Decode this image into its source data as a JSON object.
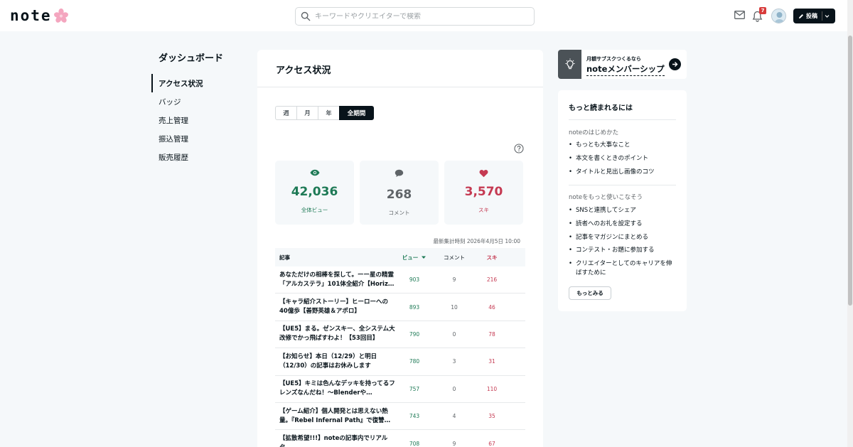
{
  "header": {
    "logo_text": "note",
    "search_placeholder": "キーワードやクリエイターで検索",
    "notification_count": "7",
    "post_label": "投稿"
  },
  "sidebar": {
    "title": "ダッシュボード",
    "items": [
      {
        "label": "アクセス状況",
        "active": true
      },
      {
        "label": "バッジ"
      },
      {
        "label": "売上管理"
      },
      {
        "label": "振込管理"
      },
      {
        "label": "販売履歴"
      }
    ]
  },
  "main": {
    "title": "アクセス状況",
    "periods": [
      "週",
      "月",
      "年",
      "全期間"
    ],
    "selected_period": "全期間",
    "stats": {
      "views": {
        "value": "42,036",
        "label": "全体ビュー"
      },
      "comments": {
        "value": "268",
        "label": "コメント"
      },
      "likes": {
        "value": "3,570",
        "label": "スキ"
      }
    },
    "updated_at": "最新集計時刻 2026年4月5日 10:00",
    "table": {
      "headers": {
        "title": "記事",
        "views": "ビュー",
        "comments": "コメント",
        "likes": "スキ"
      },
      "rows": [
        {
          "title": "あなただけの相棒を探して。ーー星の精霊「アルカステラ」101体全紹介【Horiz…",
          "views": "903",
          "comments": "9",
          "likes": "216"
        },
        {
          "title": "【キャラ紹介ストーリー】ヒーローへの40億歩【善野英雄＆アポロ】",
          "views": "893",
          "comments": "10",
          "likes": "46"
        },
        {
          "title": "【UE5】まる。ゼンスキー、全システム大改修でかっ飛ばすわよ！【53回目】",
          "views": "790",
          "comments": "0",
          "likes": "78"
        },
        {
          "title": "【お知らせ】本日（12/29）と明日（12/30）の記事はお休みします",
          "views": "780",
          "comments": "3",
          "likes": "31"
        },
        {
          "title": "【UE5】キミは色んなデッキを持ってるフレンズなんだね！〜BlenderやGemini…",
          "views": "757",
          "comments": "0",
          "likes": "110"
        },
        {
          "title": "【ゲーム紹介】個人開発とは思えない熱量。『Rebel Infernal Path』で復讐の…",
          "views": "743",
          "comments": "4",
          "likes": "35"
        },
        {
          "title": "【拡散希望!!!】noteの記事内でリアルタ…",
          "views": "708",
          "comments": "9",
          "likes": "67"
        }
      ]
    }
  },
  "banner": {
    "small": "月額サブスクつくるなら",
    "big": "noteメンバーシップ"
  },
  "tips": {
    "title": "もっと読まれるには",
    "section1": "noteのはじめかた",
    "list1": [
      "もっとも大事なこと",
      "本文を書くときのポイント",
      "タイトルと見出し画像のコツ"
    ],
    "section2": "noteをもっと使いこなそう",
    "list2": [
      "SNSと連携してシェア",
      "読者へのお礼を設定する",
      "記事をマガジンにまとめる",
      "コンテスト・お題に参加する",
      "クリエイターとしてのキャリアを伸ばすために"
    ],
    "more_label": "もっとみる"
  },
  "colors": {
    "accent": "#08131a",
    "views": "#1e7a56",
    "likes": "#c53a52",
    "badge": "#d83b3b"
  }
}
